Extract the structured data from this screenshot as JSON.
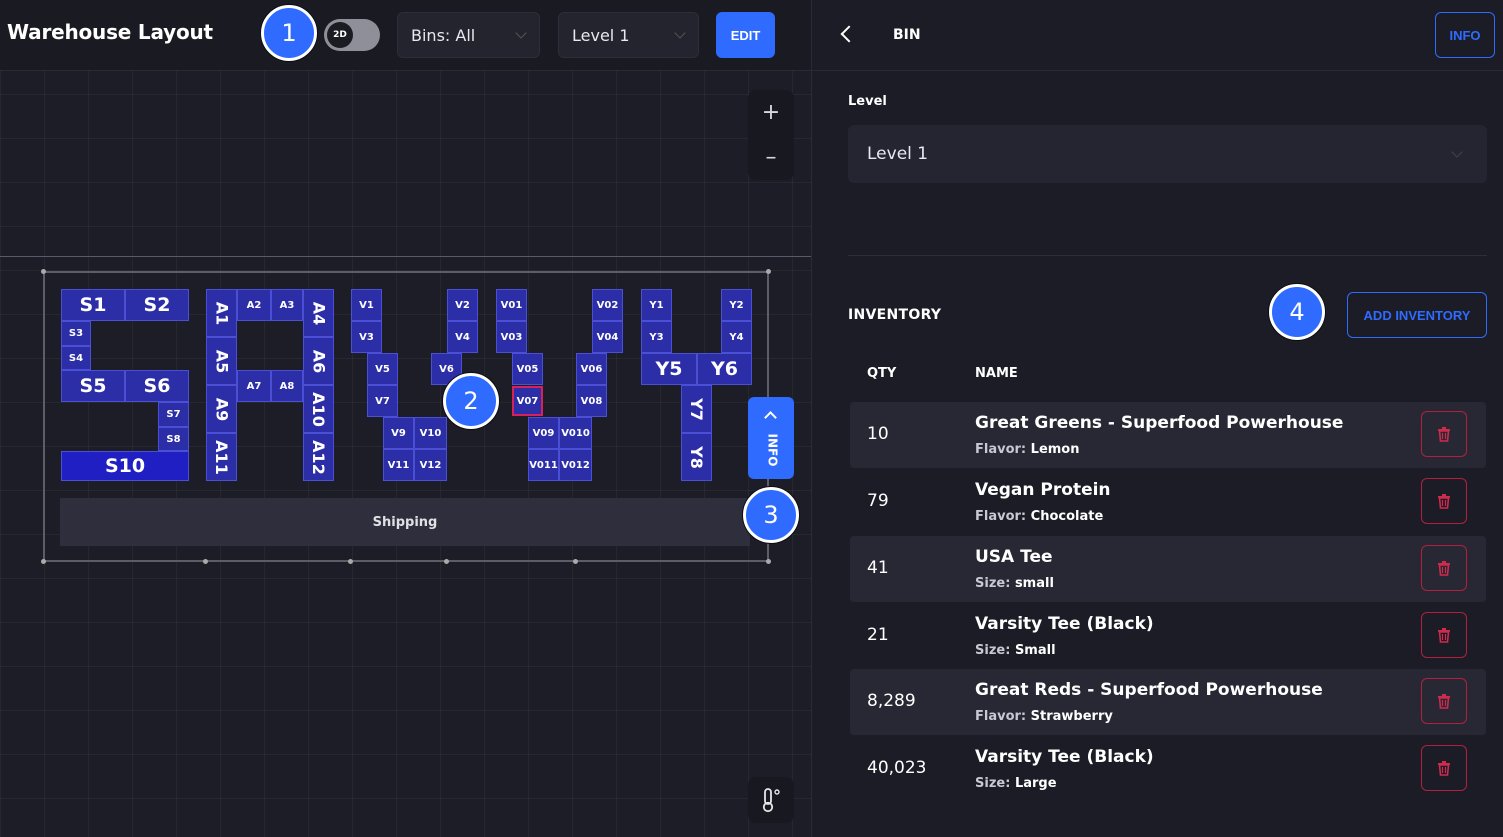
{
  "app": {
    "title": "Warehouse Layout"
  },
  "toolbar": {
    "view_toggle": "2D",
    "bins_select": "Bins: All",
    "level_select": "Level 1",
    "edit_label": "EDIT"
  },
  "map": {
    "zoom_in": "+",
    "zoom_out": "–",
    "shipping_label": "Shipping",
    "info_tab_label": "INFO",
    "bins": {
      "S1": "S1",
      "S2": "S2",
      "S3": "S3",
      "S4": "S4",
      "S5": "S5",
      "S6": "S6",
      "S7": "S7",
      "S8": "S8",
      "S10": "S10",
      "A1": "A1",
      "A2": "A2",
      "A3": "A3",
      "A4": "A4",
      "A5": "A5",
      "A6": "A6",
      "A7": "A7",
      "A8": "A8",
      "A9": "A9",
      "A10": "A10",
      "A11": "A11",
      "A12": "A12",
      "V1": "V1",
      "V2": "V2",
      "V3": "V3",
      "V4": "V4",
      "V5": "V5",
      "V6": "V6",
      "V7": "V7",
      "V9": "V9",
      "V10": "V10",
      "V11": "V11",
      "V12": "V12",
      "V01": "V01",
      "V02": "V02",
      "V03": "V03",
      "V04": "V04",
      "V05": "V05",
      "V06": "V06",
      "V07": "V07",
      "V08": "V08",
      "V09": "V09",
      "V010": "V010",
      "V011": "V011",
      "V012": "V012",
      "Y1": "Y1",
      "Y2": "Y2",
      "Y3": "Y3",
      "Y4": "Y4",
      "Y5": "Y5",
      "Y6": "Y6",
      "Y7": "Y7",
      "Y8": "Y8"
    }
  },
  "badges": {
    "b1": "1",
    "b2": "2",
    "b3": "3",
    "b4": "4"
  },
  "panel": {
    "title": "BIN",
    "info_label": "INFO",
    "level_label": "Level",
    "level_value": "Level 1",
    "inventory_title": "INVENTORY",
    "add_inventory_label": "ADD INVENTORY",
    "col_qty": "QTY",
    "col_name": "NAME",
    "rows": [
      {
        "qty": "10",
        "name": "Great Greens - Superfood Powerhouse",
        "attr_key": "Flavor:",
        "attr_val": "Lemon"
      },
      {
        "qty": "79",
        "name": "Vegan Protein",
        "attr_key": "Flavor:",
        "attr_val": "Chocolate"
      },
      {
        "qty": "41",
        "name": "USA Tee",
        "attr_key": "Size:",
        "attr_val": "small"
      },
      {
        "qty": "21",
        "name": "Varsity Tee (Black)",
        "attr_key": "Size:",
        "attr_val": "Small"
      },
      {
        "qty": "8,289",
        "name": "Great Reds - Superfood Powerhouse",
        "attr_key": "Flavor:",
        "attr_val": "Strawberry"
      },
      {
        "qty": "40,023",
        "name": "Varsity Tee (Black)",
        "attr_key": "Size:",
        "attr_val": "Large"
      }
    ]
  },
  "colors": {
    "accent": "#2f6bff",
    "bin": "#2c2ea8",
    "danger": "#b0213f"
  },
  "icons": [
    "chevron-down-icon",
    "plus-icon",
    "minus-icon",
    "chevron-left-icon",
    "thermometer-icon",
    "trash-icon"
  ]
}
